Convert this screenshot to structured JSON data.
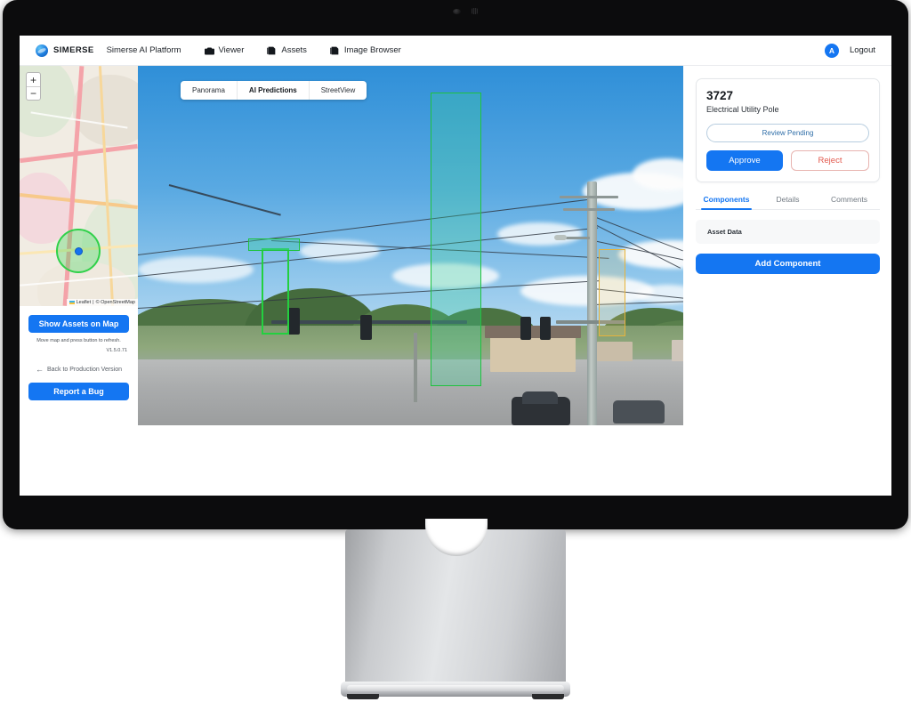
{
  "header": {
    "brand": "SIMERSE",
    "brand_icon": "simerse-globe-logo",
    "app_title": "Simerse AI Platform",
    "nav": [
      {
        "label": "Viewer",
        "icon": "camera-icon"
      },
      {
        "label": "Assets",
        "icon": "layers-icon"
      },
      {
        "label": "Image Browser",
        "icon": "layers-icon"
      }
    ],
    "avatar_initial": "A",
    "logout_label": "Logout"
  },
  "sidebar": {
    "map": {
      "zoom_in_label": "+",
      "zoom_out_label": "−",
      "attribution_leaflet": "Leaflet",
      "attribution_separator": "|",
      "attribution_osm": "© OpenStreetMap"
    },
    "show_assets_label": "Show Assets on Map",
    "hint": "Move map and press button to refresh.",
    "version": "V1.5.0.71",
    "back_link_label": "Back to Production Version",
    "back_link_icon": "arrow-left-icon",
    "report_bug_label": "Report a Bug"
  },
  "viewer": {
    "tabs": [
      {
        "label": "Panorama",
        "active": false
      },
      {
        "label": "AI Predictions",
        "active": true
      },
      {
        "label": "StreetView",
        "active": false
      }
    ],
    "detections": [
      {
        "name": "selected-utility-pole",
        "color": "#1fc23f",
        "fill": "rgba(60,210,150,0.30)"
      },
      {
        "name": "secondary-pole",
        "color": "#23d03f",
        "fill": "rgba(0,0,0,0)"
      },
      {
        "name": "distant-pole",
        "color": "#e6b33c",
        "fill": "rgba(240,205,110,0.22)"
      },
      {
        "name": "traffic-signal-arm",
        "color": "#1fc23f",
        "fill": "rgba(60,200,170,0.42)"
      }
    ]
  },
  "panel": {
    "asset_id": "3727",
    "asset_type": "Electrical Utility Pole",
    "status_label": "Review Pending",
    "approve_label": "Approve",
    "reject_label": "Reject",
    "tabs": [
      {
        "label": "Components",
        "active": true
      },
      {
        "label": "Details",
        "active": false
      },
      {
        "label": "Comments",
        "active": false
      }
    ],
    "components": [
      {
        "label": "Asset Data"
      }
    ],
    "add_component_label": "Add Component"
  },
  "colors": {
    "accent": "#1476f2",
    "reject": "#e2584c",
    "detection_green": "#1fc23f",
    "detection_amber": "#e6b33c"
  }
}
